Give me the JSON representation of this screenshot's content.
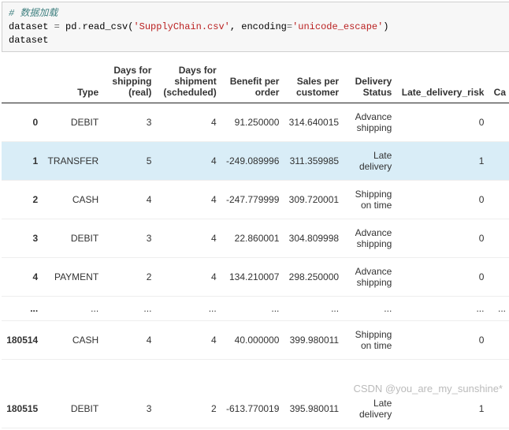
{
  "code": {
    "comment": "# 数据加载",
    "line2_a": "dataset ",
    "line2_b": "= ",
    "line2_c": "pd",
    "line2_d": ".",
    "line2_e": "read_csv(",
    "line2_f": "'SupplyChain.csv'",
    "line2_g": ", encoding",
    "line2_h": "=",
    "line2_i": "'unicode_escape'",
    "line2_j": ")",
    "line3": "dataset"
  },
  "table": {
    "headers": [
      "",
      "Type",
      "Days for shipping (real)",
      "Days for shipment (scheduled)",
      "Benefit per order",
      "Sales per customer",
      "Delivery Status",
      "Late_delivery_risk",
      "Ca"
    ],
    "rows": [
      {
        "idx": "0",
        "type": "DEBIT",
        "dsr": "3",
        "dss": "4",
        "bpo": "91.250000",
        "spc": "314.640015",
        "ds": "Advance shipping",
        "ldr": "0"
      },
      {
        "idx": "1",
        "type": "TRANSFER",
        "dsr": "5",
        "dss": "4",
        "bpo": "-249.089996",
        "spc": "311.359985",
        "ds": "Late delivery",
        "ldr": "1",
        "hl": true
      },
      {
        "idx": "2",
        "type": "CASH",
        "dsr": "4",
        "dss": "4",
        "bpo": "-247.779999",
        "spc": "309.720001",
        "ds": "Shipping on time",
        "ldr": "0"
      },
      {
        "idx": "3",
        "type": "DEBIT",
        "dsr": "3",
        "dss": "4",
        "bpo": "22.860001",
        "spc": "304.809998",
        "ds": "Advance shipping",
        "ldr": "0"
      },
      {
        "idx": "4",
        "type": "PAYMENT",
        "dsr": "2",
        "dss": "4",
        "bpo": "134.210007",
        "spc": "298.250000",
        "ds": "Advance shipping",
        "ldr": "0"
      },
      {
        "ellipsis": true
      },
      {
        "idx": "180514",
        "type": "CASH",
        "dsr": "4",
        "dss": "4",
        "bpo": "40.000000",
        "spc": "399.980011",
        "ds": "Shipping on time",
        "ldr": "0"
      },
      {
        "blank": true
      },
      {
        "idx": "180515",
        "type": "DEBIT",
        "dsr": "3",
        "dss": "2",
        "bpo": "-613.770019",
        "spc": "395.980011",
        "ds": "Late delivery",
        "ldr": "1"
      }
    ]
  },
  "watermark": "CSDN @you_are_my_sunshine*"
}
